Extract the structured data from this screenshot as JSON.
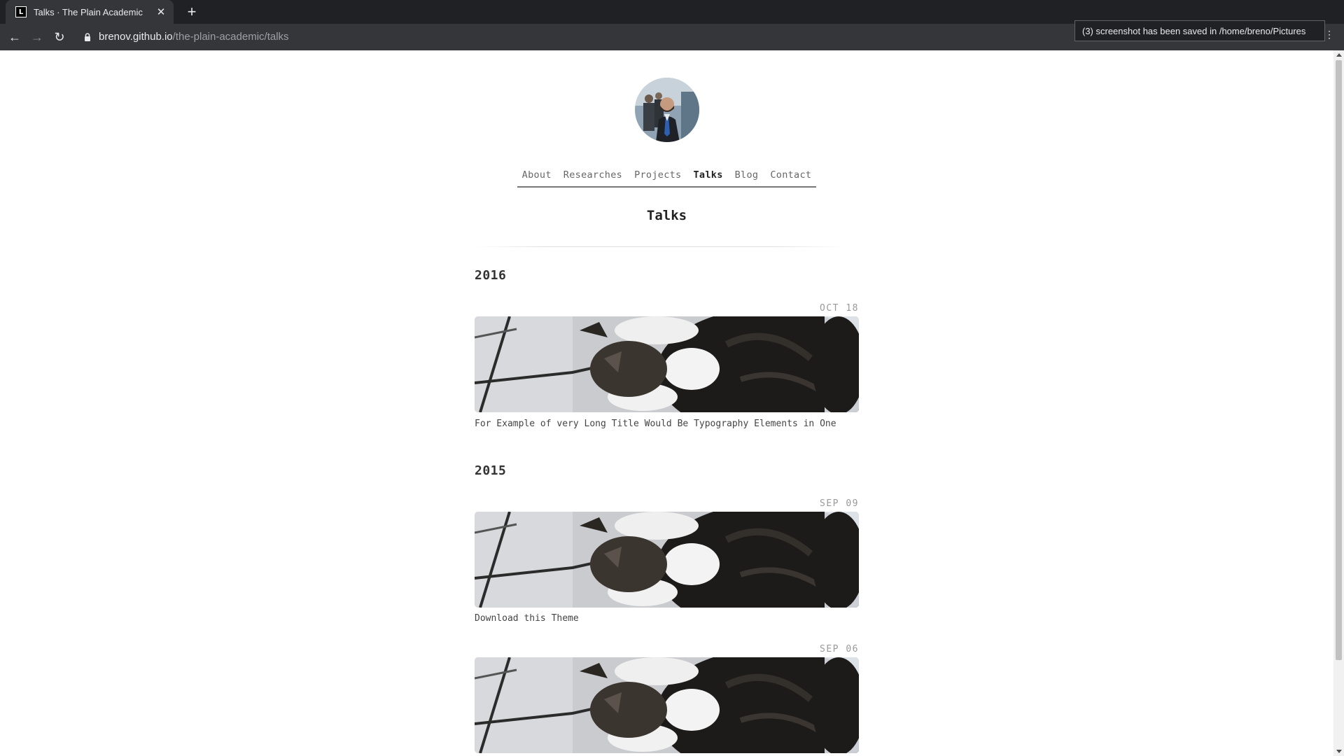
{
  "browser": {
    "tab_title": "Talks · The Plain Academic",
    "favicon_text": "L",
    "url_host": "brenov.github.io",
    "url_path": "/the-plain-academic/talks",
    "toast": "(3) screenshot has been saved in /home/breno/Pictures"
  },
  "site": {
    "nav": [
      {
        "label": "About",
        "active": false
      },
      {
        "label": "Researches",
        "active": false
      },
      {
        "label": "Projects",
        "active": false
      },
      {
        "label": "Talks",
        "active": true
      },
      {
        "label": "Blog",
        "active": false
      },
      {
        "label": "Contact",
        "active": false
      }
    ],
    "page_title": "Talks"
  },
  "talks": {
    "years": [
      {
        "year": "2016",
        "items": [
          {
            "date": "OCT 18",
            "title": "For Example of very Long Title Would Be Typography Elements in One"
          }
        ]
      },
      {
        "year": "2015",
        "items": [
          {
            "date": "SEP 09",
            "title": "Download this Theme"
          },
          {
            "date": "SEP 06",
            "title": ""
          }
        ]
      }
    ]
  },
  "colors": {
    "chrome_dark": "#202124",
    "chrome_toolbar": "#35363a",
    "text_primary": "#222222",
    "text_muted": "#999999"
  },
  "icons": {
    "back": "arrow-left-icon",
    "forward": "arrow-right-icon",
    "reload": "reload-icon",
    "lock": "lock-icon",
    "close": "close-icon",
    "new_tab": "plus-icon",
    "menu": "kebab-menu-icon"
  }
}
